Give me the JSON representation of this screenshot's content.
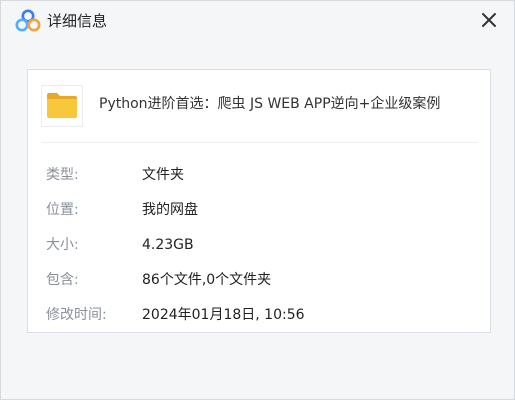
{
  "window": {
    "title": "详细信息",
    "logo_icon": "baidu-netdisk-cloud-icon",
    "close_icon": "close-icon"
  },
  "file": {
    "icon": "folder-icon",
    "name": "Python进阶首选：爬虫 JS WEB APP逆向+企业级案例"
  },
  "details": [
    {
      "label": "类型:",
      "value": "文件夹"
    },
    {
      "label": "位置:",
      "value": "我的网盘"
    },
    {
      "label": "大小:",
      "value": "4.23GB"
    },
    {
      "label": "包含:",
      "value": "86个文件,0个文件夹"
    },
    {
      "label": "修改时间:",
      "value": "2024年01月18日, 10:56"
    }
  ],
  "colors": {
    "accent_blue": "#3a7bf6",
    "folder_yellow": "#f9c73b",
    "label_gray": "#8a8f99"
  }
}
